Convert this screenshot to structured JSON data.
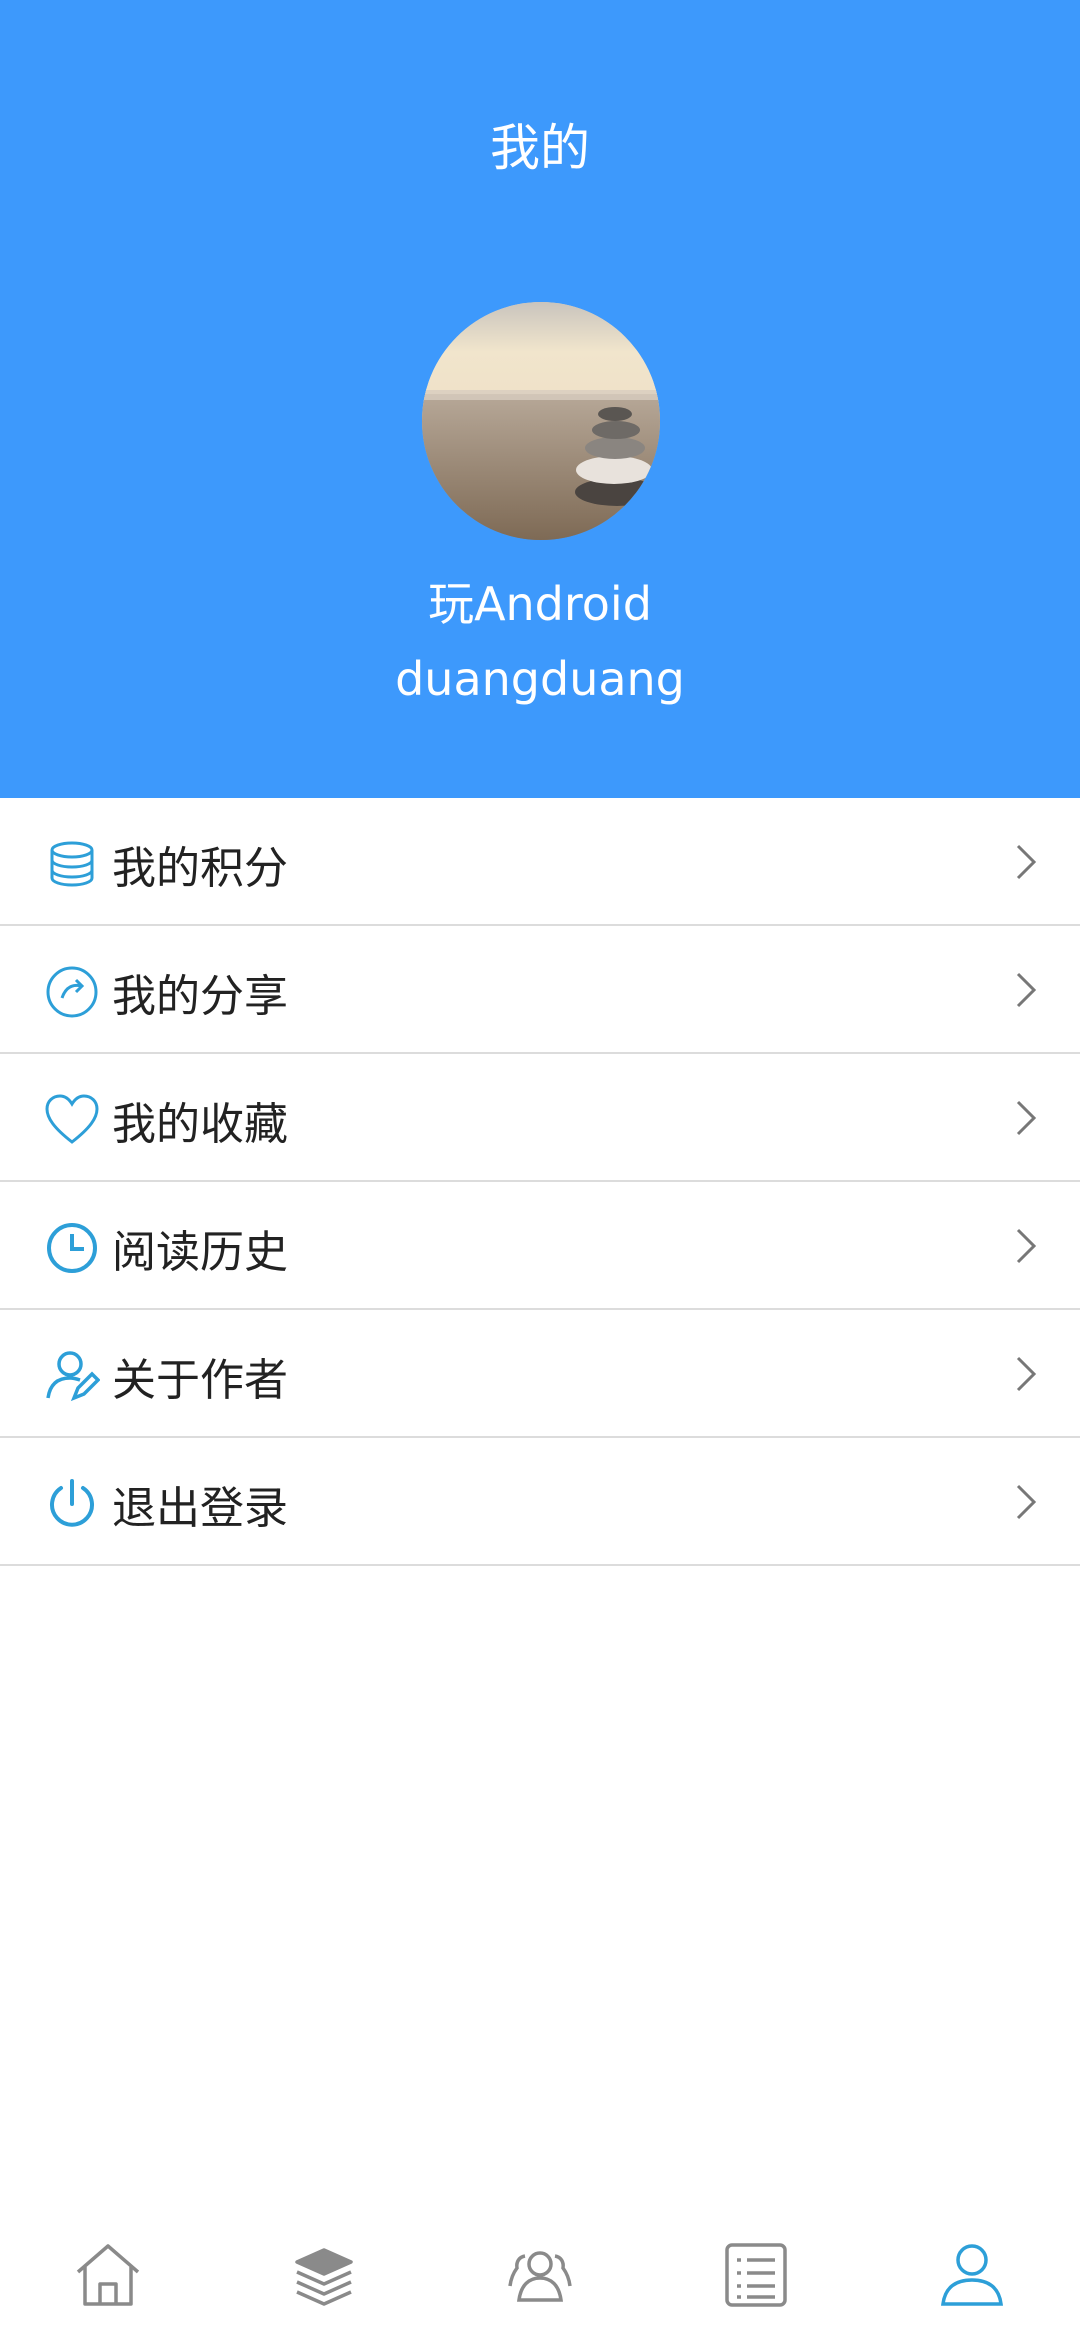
{
  "header": {
    "title": "我的",
    "site_name": "玩Android",
    "username": "duangduang"
  },
  "menu": {
    "items": [
      {
        "label": "我的积分",
        "icon": "coins-icon"
      },
      {
        "label": "我的分享",
        "icon": "share-icon"
      },
      {
        "label": "我的收藏",
        "icon": "heart-icon"
      },
      {
        "label": "阅读历史",
        "icon": "clock-icon"
      },
      {
        "label": "关于作者",
        "icon": "user-edit-icon"
      },
      {
        "label": "退出登录",
        "icon": "power-icon"
      }
    ]
  },
  "bottom_nav": {
    "items": [
      {
        "name": "home",
        "icon": "home-icon",
        "active": false
      },
      {
        "name": "system",
        "icon": "layers-icon",
        "active": false
      },
      {
        "name": "public-account",
        "icon": "group-icon",
        "active": false
      },
      {
        "name": "project",
        "icon": "list-icon",
        "active": false
      },
      {
        "name": "mine",
        "icon": "person-icon",
        "active": true
      }
    ]
  },
  "colors": {
    "header_bg": "#3d99fc",
    "icon_blue": "#2d9fd8",
    "nav_inactive": "#8a8a8a",
    "nav_active": "#2d9fd8"
  }
}
